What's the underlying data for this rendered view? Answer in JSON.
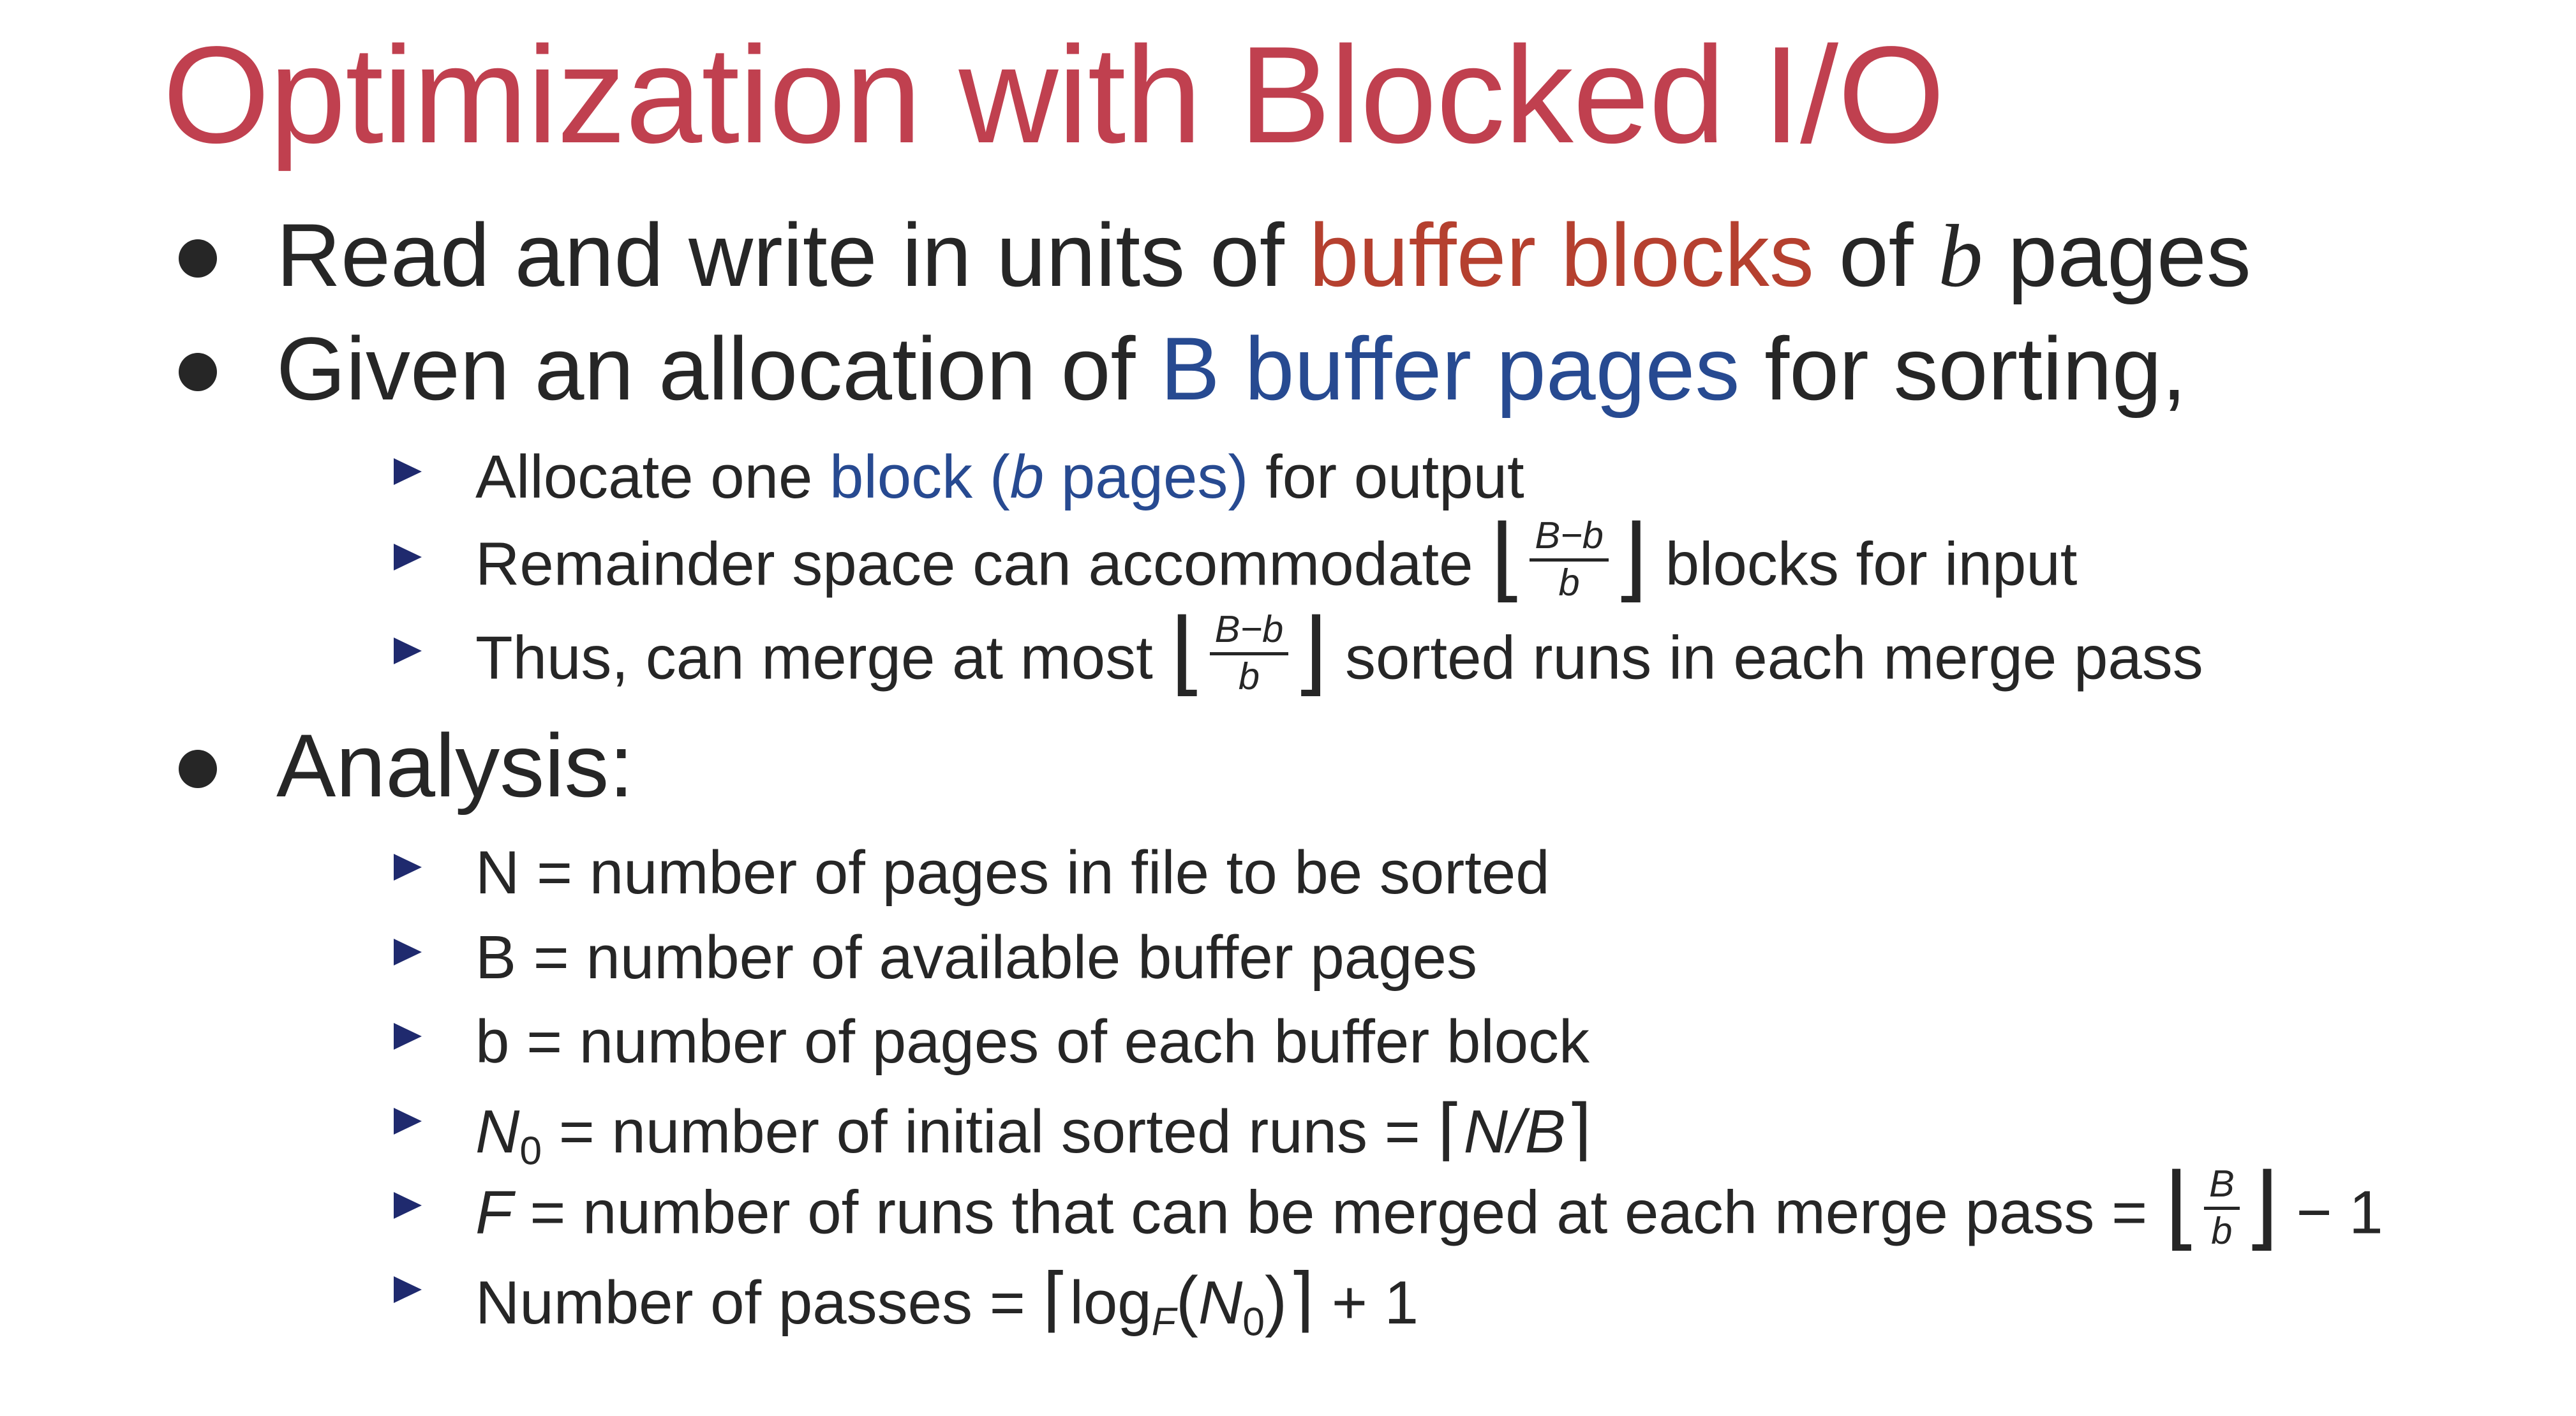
{
  "slide": {
    "title": "Optimization with Blocked I/O",
    "bullets": {
      "b1": {
        "pre": "Read and write in units of ",
        "highlight": "buffer blocks",
        "mid": " of ",
        "var": "b",
        "post": " pages"
      },
      "b2": {
        "pre": "Given an allocation of ",
        "highlight": "B buffer pages",
        "post": " for sorting,",
        "subs": {
          "s1": {
            "pre": "Allocate one ",
            "hl1": "block (",
            "var": "b",
            "hl2": " pages)",
            "post": " for output"
          },
          "s2": {
            "pre": "Remainder space can accommodate ",
            "num": "B−b",
            "den": "b",
            "post": " blocks for input"
          },
          "s3": {
            "pre": "Thus, can merge at most ",
            "num": "B−b",
            "den": "b",
            "post": " sorted runs in each merge pass"
          }
        }
      },
      "b3": {
        "text": "Analysis:",
        "subs": {
          "s1": {
            "text": "N = number of pages in file to be sorted"
          },
          "s2": {
            "text": "B = number of available buffer pages"
          },
          "s3": {
            "text": "b = number of pages of each buffer block"
          },
          "s4": {
            "var": "N",
            "sub": "0",
            "mid": " = number of initial sorted runs = ",
            "expr": "N/B"
          },
          "s5": {
            "var": "F",
            "mid": " = number of runs that can be merged at each merge pass = ",
            "num": "B",
            "den": "b",
            "tail": " − 1"
          },
          "s6": {
            "pre": "Number of passes = ",
            "log": "log",
            "logsub": "F",
            "open": "(",
            "argvar": "N",
            "argsub": "0",
            "close": ")",
            "tail": " + 1"
          }
        }
      }
    }
  }
}
